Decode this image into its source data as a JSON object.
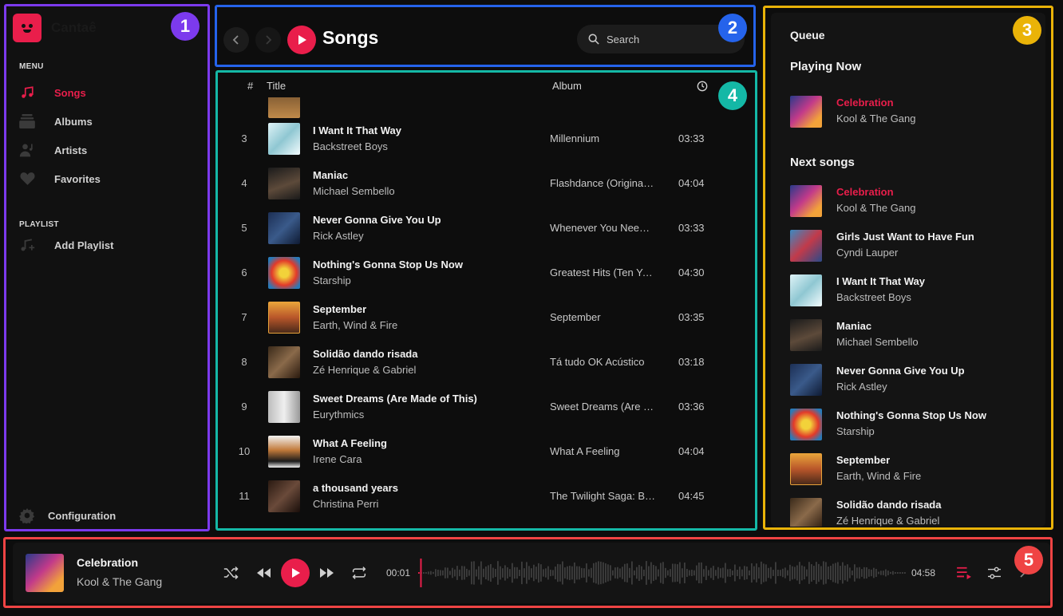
{
  "app": {
    "name": "Cantaê"
  },
  "sidebar": {
    "menu_label": "MENU",
    "items": [
      {
        "label": "Songs",
        "icon": "music-note-icon",
        "active": true
      },
      {
        "label": "Albums",
        "icon": "albums-icon",
        "active": false
      },
      {
        "label": "Artists",
        "icon": "artists-icon",
        "active": false
      },
      {
        "label": "Favorites",
        "icon": "heart-icon",
        "active": false
      }
    ],
    "playlist_label": "PLAYLIST",
    "add_playlist_label": "Add Playlist",
    "config_label": "Configuration"
  },
  "header": {
    "title": "Songs",
    "search_placeholder": "Search"
  },
  "song_list": {
    "columns": {
      "num": "#",
      "title": "Title",
      "album": "Album",
      "duration_icon": "clock-icon"
    },
    "rows": [
      {
        "num": "3",
        "title": "I Want It That Way",
        "artist": "Backstreet Boys",
        "album": "Millennium",
        "duration": "03:33"
      },
      {
        "num": "4",
        "title": "Maniac",
        "artist": "Michael Sembello",
        "album": "Flashdance (Original Soundtrack)",
        "duration": "04:04"
      },
      {
        "num": "5",
        "title": "Never Gonna Give You Up",
        "artist": "Rick Astley",
        "album": "Whenever You Need Somebody",
        "duration": "03:33"
      },
      {
        "num": "6",
        "title": "Nothing's Gonna Stop Us Now",
        "artist": "Starship",
        "album": "Greatest Hits (Ten Years and Change)",
        "duration": "04:30"
      },
      {
        "num": "7",
        "title": "September",
        "artist": "Earth, Wind & Fire",
        "album": "September",
        "duration": "03:35"
      },
      {
        "num": "8",
        "title": "Solidão dando risada",
        "artist": "Zé Henrique & Gabriel",
        "album": "Tá tudo OK Acústico",
        "duration": "03:18"
      },
      {
        "num": "9",
        "title": "Sweet Dreams (Are Made of This)",
        "artist": "Eurythmics",
        "album": "Sweet Dreams (Are Made of This)",
        "duration": "03:36"
      },
      {
        "num": "10",
        "title": "What A Feeling",
        "artist": "Irene Cara",
        "album": "What A Feeling",
        "duration": "04:04"
      },
      {
        "num": "11",
        "title": "a thousand years",
        "artist": "Christina Perri",
        "album": "The Twilight Saga: Breaking Dawn",
        "duration": "04:45"
      }
    ]
  },
  "queue": {
    "title": "Queue",
    "playing_now_label": "Playing Now",
    "playing_now": {
      "title": "Celebration",
      "artist": "Kool & The Gang"
    },
    "next_label": "Next songs",
    "next": [
      {
        "title": "Celebration",
        "artist": "Kool & The Gang",
        "playing": true
      },
      {
        "title": "Girls Just Want to Have Fun",
        "artist": "Cyndi Lauper",
        "playing": false
      },
      {
        "title": "I Want It That Way",
        "artist": "Backstreet Boys",
        "playing": false
      },
      {
        "title": "Maniac",
        "artist": "Michael Sembello",
        "playing": false
      },
      {
        "title": "Never Gonna Give You Up",
        "artist": "Rick Astley",
        "playing": false
      },
      {
        "title": "Nothing's Gonna Stop Us Now",
        "artist": "Starship",
        "playing": false
      },
      {
        "title": "September",
        "artist": "Earth, Wind & Fire",
        "playing": false
      },
      {
        "title": "Solidão dando risada",
        "artist": "Zé Henrique & Gabriel",
        "playing": false
      }
    ]
  },
  "player": {
    "title": "Celebration",
    "artist": "Kool & The Gang",
    "current_time": "00:01",
    "total_time": "04:58",
    "progress": 0.004,
    "controls": [
      "shuffle-icon",
      "previous-icon",
      "play-icon",
      "next-icon",
      "repeat-icon",
      "queue-icon",
      "equalizer-icon",
      "volume-icon"
    ]
  },
  "annotations": [
    {
      "label": "1",
      "color": "#7c3aed"
    },
    {
      "label": "2",
      "color": "#2563eb"
    },
    {
      "label": "3",
      "color": "#eab308"
    },
    {
      "label": "4",
      "color": "#14b8a6"
    },
    {
      "label": "5",
      "color": "#ef4444"
    }
  ],
  "colors": {
    "accent": "#e91e4b",
    "background": "#0d0d0d",
    "panel": "#141414"
  }
}
